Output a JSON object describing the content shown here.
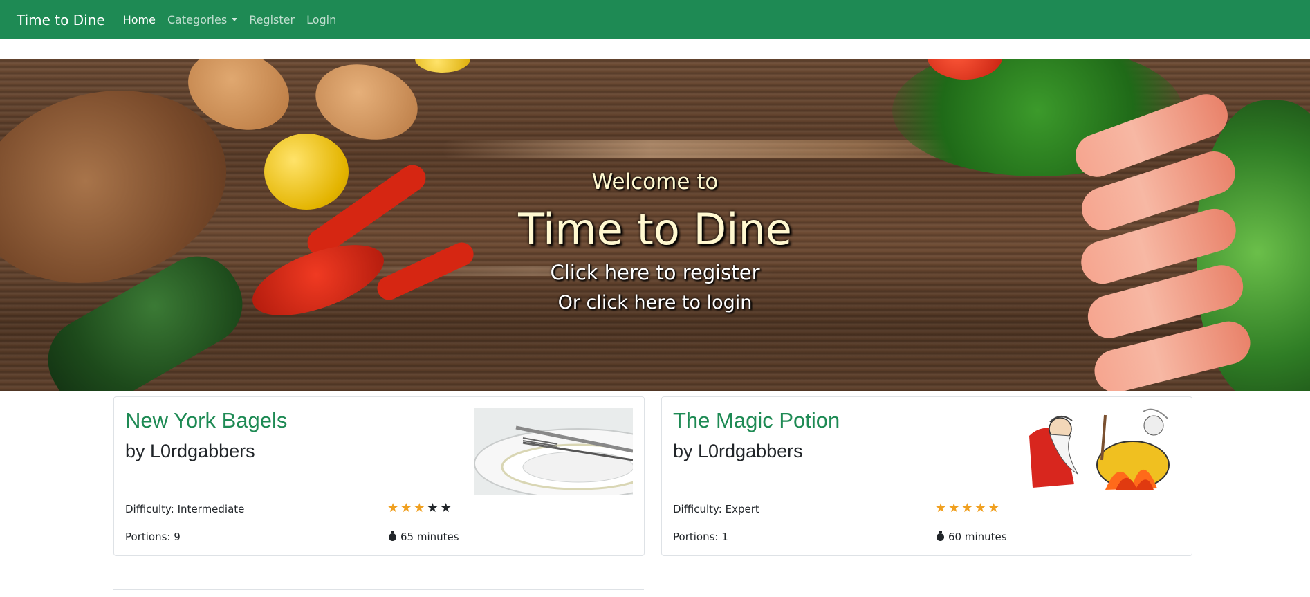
{
  "navbar": {
    "brand": "Time to Dine",
    "links": [
      "Home",
      "Categories",
      "Register",
      "Login"
    ]
  },
  "hero": {
    "welcome": "Welcome to",
    "title": "Time to Dine",
    "register_link": "Click here to register",
    "login_link": "Or click here to login"
  },
  "recipes": [
    {
      "title": "New York Bagels",
      "author": "by L0rdgabbers",
      "difficulty": "Difficulty: Intermediate",
      "portions": "Portions: 9",
      "time": "65 minutes",
      "rating": 3,
      "rating_max": 5
    },
    {
      "title": "The Magic Potion",
      "author": "by L0rdgabbers",
      "difficulty": "Difficulty: Expert",
      "portions": "Portions: 1",
      "time": "60 minutes",
      "rating": 5,
      "rating_max": 5
    }
  ],
  "colors": {
    "navbar": "#1e8a54",
    "accent": "#1e8a54",
    "star_on": "#f0a020",
    "star_off": "#212529"
  }
}
